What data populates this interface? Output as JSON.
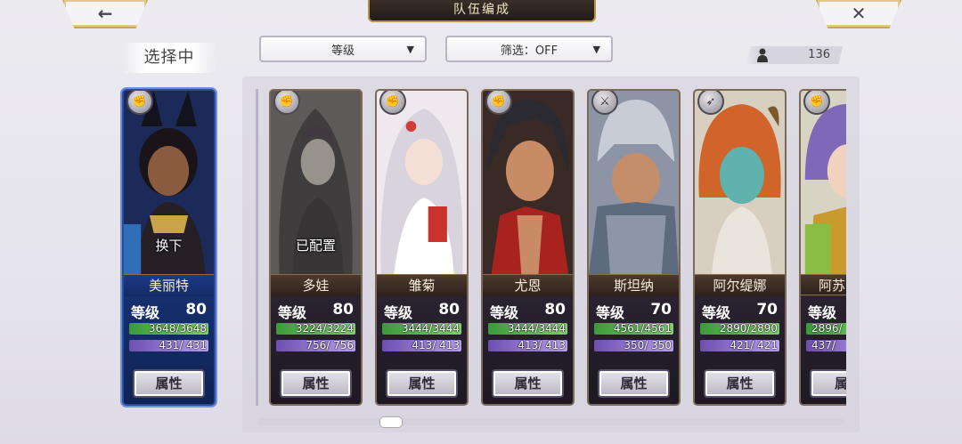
{
  "header": {
    "title": "队伍编成",
    "back_icon": "←",
    "close_icon": "✕"
  },
  "selecting_label": "选择中",
  "sort_dropdown": {
    "value": "等级",
    "caret": "▼"
  },
  "filter_dropdown": {
    "value": "筛选：OFF",
    "caret": "▼"
  },
  "unit_count": "136",
  "selected_unit": {
    "name": "美丽特",
    "overlay": "换下",
    "level_label": "等级",
    "level": "80",
    "hp": "3648/3648",
    "mp": "431/ 431",
    "attr_button": "属性",
    "badge": "hand-icon"
  },
  "units": [
    {
      "name": "多娃",
      "overlay": "已配置",
      "level_label": "等级",
      "level": "80",
      "hp": "3224/3224",
      "mp": "756/ 756",
      "attr_button": "属性",
      "badge": "hand-icon"
    },
    {
      "name": "雏菊",
      "overlay": "",
      "level_label": "等级",
      "level": "80",
      "hp": "3444/3444",
      "mp": "413/ 413",
      "attr_button": "属性",
      "badge": "hand-icon"
    },
    {
      "name": "尤恩",
      "overlay": "",
      "level_label": "等级",
      "level": "80",
      "hp": "3444/3444",
      "mp": "413/ 413",
      "attr_button": "属性",
      "badge": "hand-icon"
    },
    {
      "name": "斯坦纳",
      "overlay": "",
      "level_label": "等级",
      "level": "70",
      "hp": "4561/4561",
      "mp": "350/ 350",
      "attr_button": "属性",
      "badge": "sword-icon"
    },
    {
      "name": "阿尔缇娜",
      "overlay": "",
      "level_label": "等级",
      "level": "70",
      "hp": "2890/2890",
      "mp": "421/ 421",
      "attr_button": "属性",
      "badge": "bow-icon"
    },
    {
      "name": "阿苏",
      "overlay": "",
      "level_label": "等级",
      "level": "",
      "hp": "2896/",
      "mp": "437/",
      "attr_button": "属",
      "badge": "hand-icon"
    }
  ],
  "colors": {
    "hp_bar": "#5cb84f",
    "mp_bar": "#9a7fd8",
    "selected_border": "#2d4b9a",
    "card_border": "#7b6a58"
  }
}
